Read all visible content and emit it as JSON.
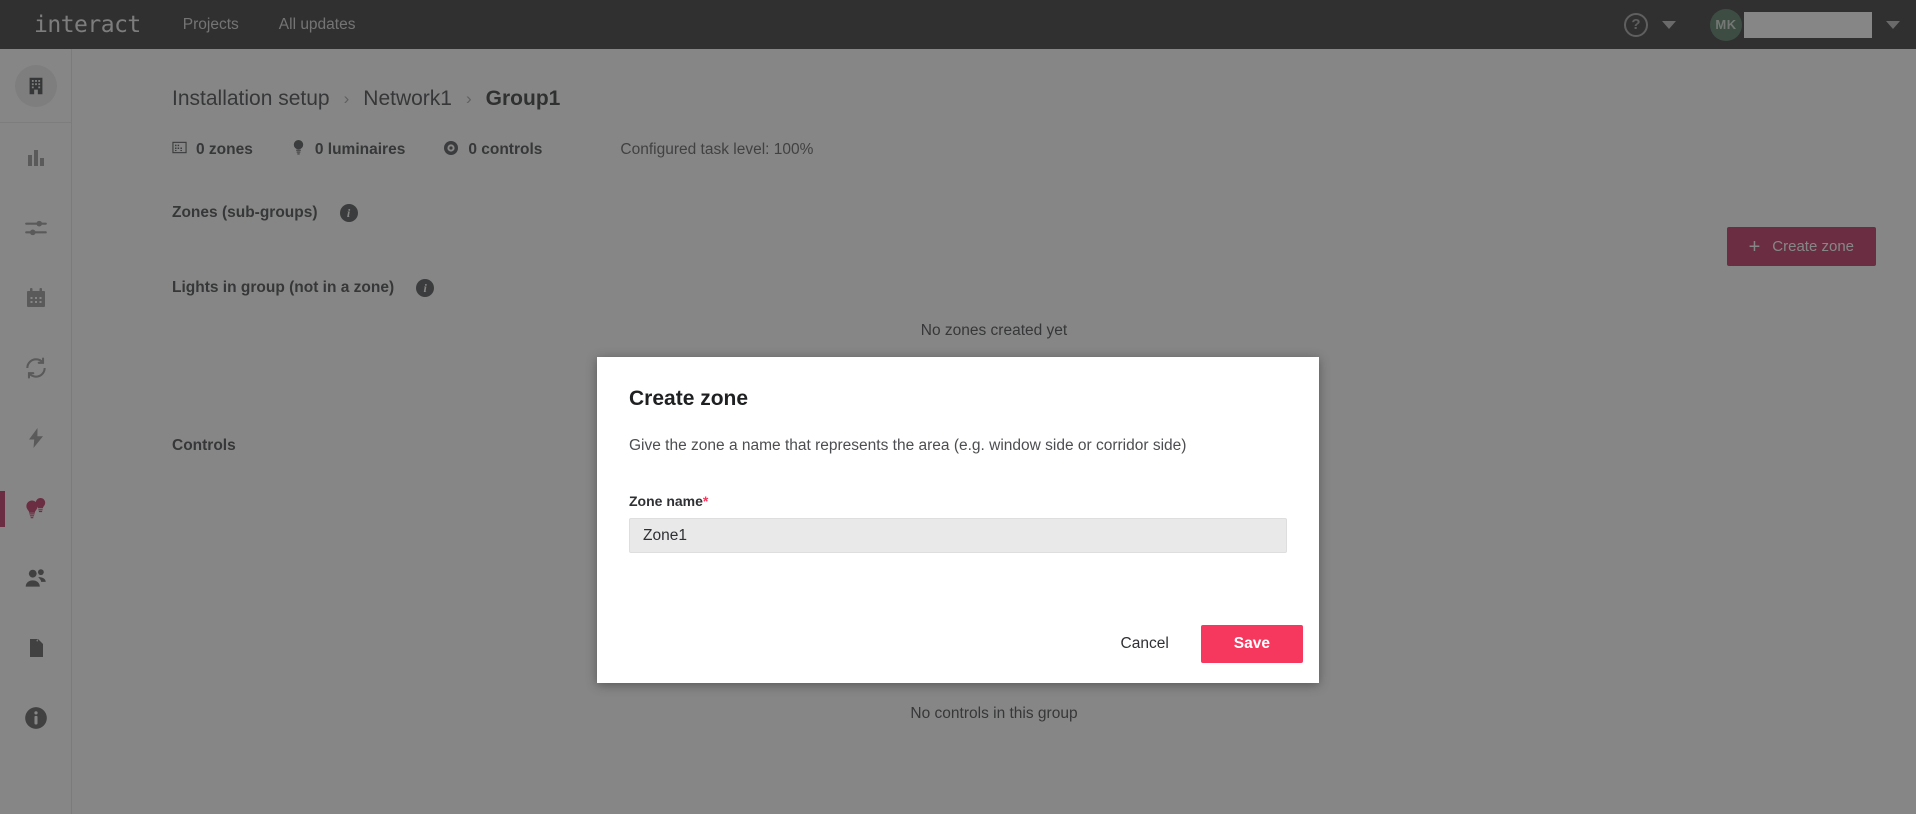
{
  "topbar": {
    "brand": "interact",
    "nav": [
      {
        "label": "Projects"
      },
      {
        "label": "All updates"
      }
    ],
    "help_icon": "?",
    "avatar_initials": "MK",
    "colors": {
      "background": "#1d1e20",
      "avatar": "#3f6b50"
    }
  },
  "sidebar": {
    "items": [
      {
        "name": "building-icon",
        "label": "Installation setup",
        "active": false,
        "badge": true
      },
      {
        "name": "bar-chart-icon",
        "label": "Insights",
        "active": false
      },
      {
        "name": "sliders-icon",
        "label": "Settings",
        "active": false
      },
      {
        "name": "calendar-icon",
        "label": "Schedules",
        "active": false
      },
      {
        "name": "sync-icon",
        "label": "Sync",
        "active": false
      },
      {
        "name": "lightning-icon",
        "label": "Energy",
        "active": false
      },
      {
        "name": "lightbulbs-icon",
        "label": "Lighting",
        "active": true
      },
      {
        "name": "users-icon",
        "label": "Users",
        "active": false
      },
      {
        "name": "document-icon",
        "label": "Reports",
        "active": false
      },
      {
        "name": "info-icon",
        "label": "About",
        "active": false
      }
    ]
  },
  "breadcrumb": {
    "items": [
      {
        "label": "Installation setup",
        "current": false
      },
      {
        "label": "Network1",
        "current": false
      },
      {
        "label": "Group1",
        "current": true
      }
    ],
    "separator": "›"
  },
  "stats": {
    "zones": "0 zones",
    "luminaires": "0 luminaires",
    "controls": "0 controls",
    "task_level": "Configured task level: 100%"
  },
  "sections": {
    "zones": {
      "heading": "Zones (sub-groups)",
      "info": "i",
      "empty": "No zones created yet",
      "create_button": "Create zone",
      "create_button_icon": "+"
    },
    "lights": {
      "heading": "Lights in group (not in a zone)",
      "info": "i"
    },
    "controls": {
      "heading": "Controls",
      "empty": "No controls in this group"
    }
  },
  "modal": {
    "title": "Create zone",
    "description": "Give the zone a name that represents the area (e.g. window side or corridor side)",
    "field_label": "Zone name",
    "required_mark": "*",
    "field_value": "Zone1",
    "field_placeholder": "Zone name",
    "cancel_label": "Cancel",
    "save_label": "Save",
    "colors": {
      "save": "#f6385f",
      "required": "#f6385f"
    }
  },
  "theme": {
    "accent_primary": "#b5174d",
    "accent_secondary": "#f6385f",
    "topbar_bg": "#1d1e20"
  }
}
